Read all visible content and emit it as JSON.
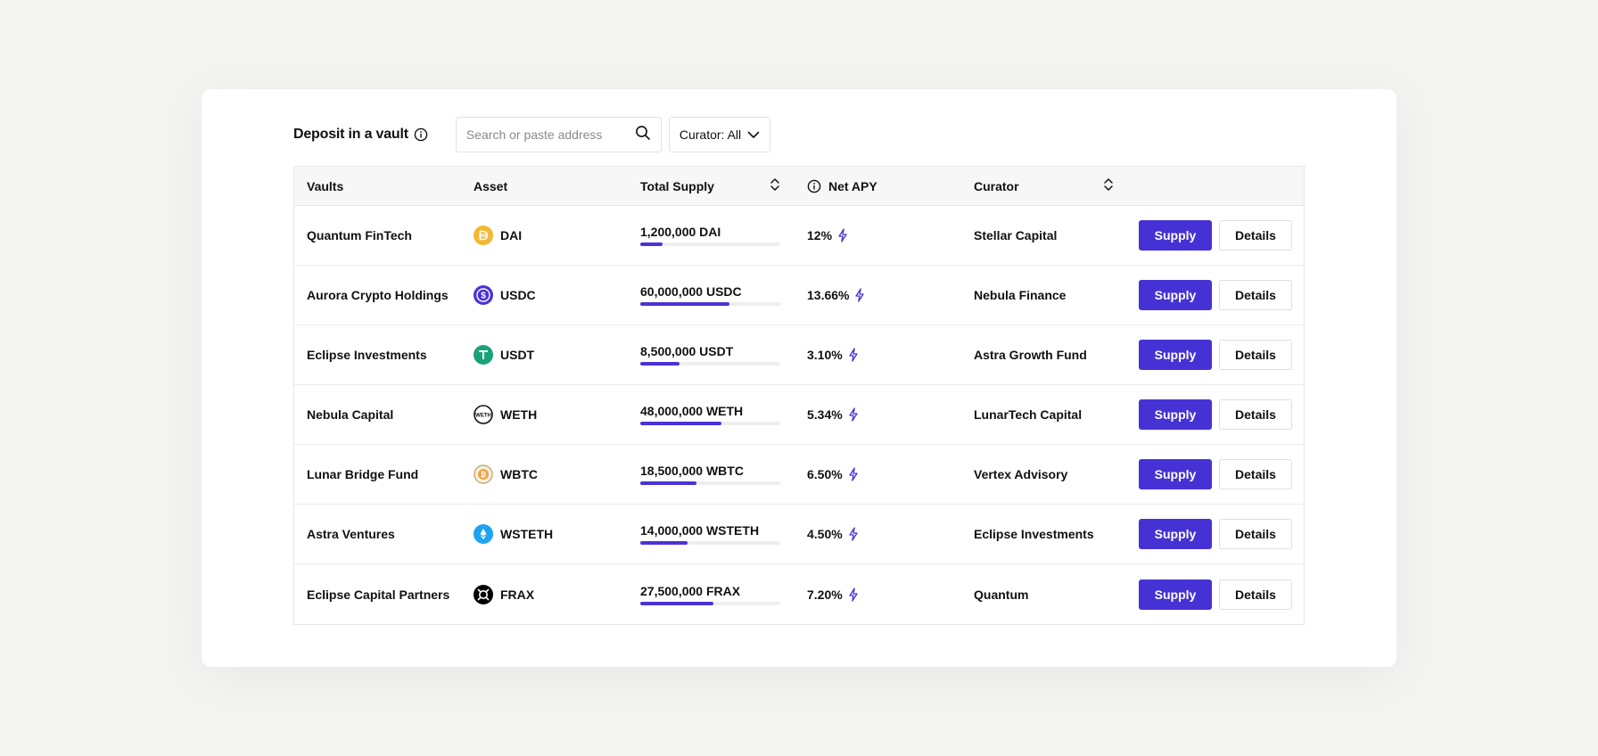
{
  "toolbar": {
    "title": "Deposit in a vault",
    "search_placeholder": "Search or paste address",
    "curator_filter": "Curator: All"
  },
  "table": {
    "headers": {
      "vaults": "Vaults",
      "asset": "Asset",
      "total_supply": "Total Supply",
      "net_apy": "Net APY",
      "curator": "Curator"
    },
    "supply_label": "Supply",
    "details_label": "Details",
    "rows": [
      {
        "vault": "Quantum FinTech",
        "asset": "DAI",
        "asset_icon": "dai-icon",
        "asset_color": "#f4b731",
        "supply": "1,200,000 DAI",
        "supply_fraction": 0.16,
        "apy": "12%",
        "curator": "Stellar Capital"
      },
      {
        "vault": "Aurora Crypto Holdings",
        "asset": "USDC",
        "asset_icon": "usdc-icon",
        "asset_color": "#4a33d6",
        "supply": "60,000,000 USDC",
        "supply_fraction": 0.64,
        "apy": "13.66%",
        "curator": "Nebula Finance"
      },
      {
        "vault": "Eclipse Investments",
        "asset": "USDT",
        "asset_icon": "usdt-icon",
        "asset_color": "#1ba27a",
        "supply": "8,500,000 USDT",
        "supply_fraction": 0.28,
        "apy": "3.10%",
        "curator": "Astra Growth Fund"
      },
      {
        "vault": "Nebula Capital",
        "asset": "WETH",
        "asset_icon": "weth-icon",
        "asset_color": "#111111",
        "supply": "48,000,000 WETH",
        "supply_fraction": 0.58,
        "apy": "5.34%",
        "curator": "LunarTech Capital"
      },
      {
        "vault": "Lunar Bridge Fund",
        "asset": "WBTC",
        "asset_icon": "wbtc-icon",
        "asset_color": "#c9a96e",
        "supply": "18,500,000 WBTC",
        "supply_fraction": 0.4,
        "apy": "6.50%",
        "curator": "Vertex Advisory"
      },
      {
        "vault": "Astra Ventures",
        "asset": "WSTETH",
        "asset_icon": "wsteth-icon",
        "asset_color": "#1fa3f0",
        "supply": "14,000,000 WSTETH",
        "supply_fraction": 0.34,
        "apy": "4.50%",
        "curator": "Eclipse Investments"
      },
      {
        "vault": "Eclipse Capital Partners",
        "asset": "FRAX",
        "asset_icon": "frax-icon",
        "asset_color": "#000000",
        "supply": "27,500,000 FRAX",
        "supply_fraction": 0.52,
        "apy": "7.20%",
        "curator": "Quantum"
      }
    ]
  },
  "colors": {
    "accent": "#4632d4",
    "background": "#f4f4f3"
  }
}
